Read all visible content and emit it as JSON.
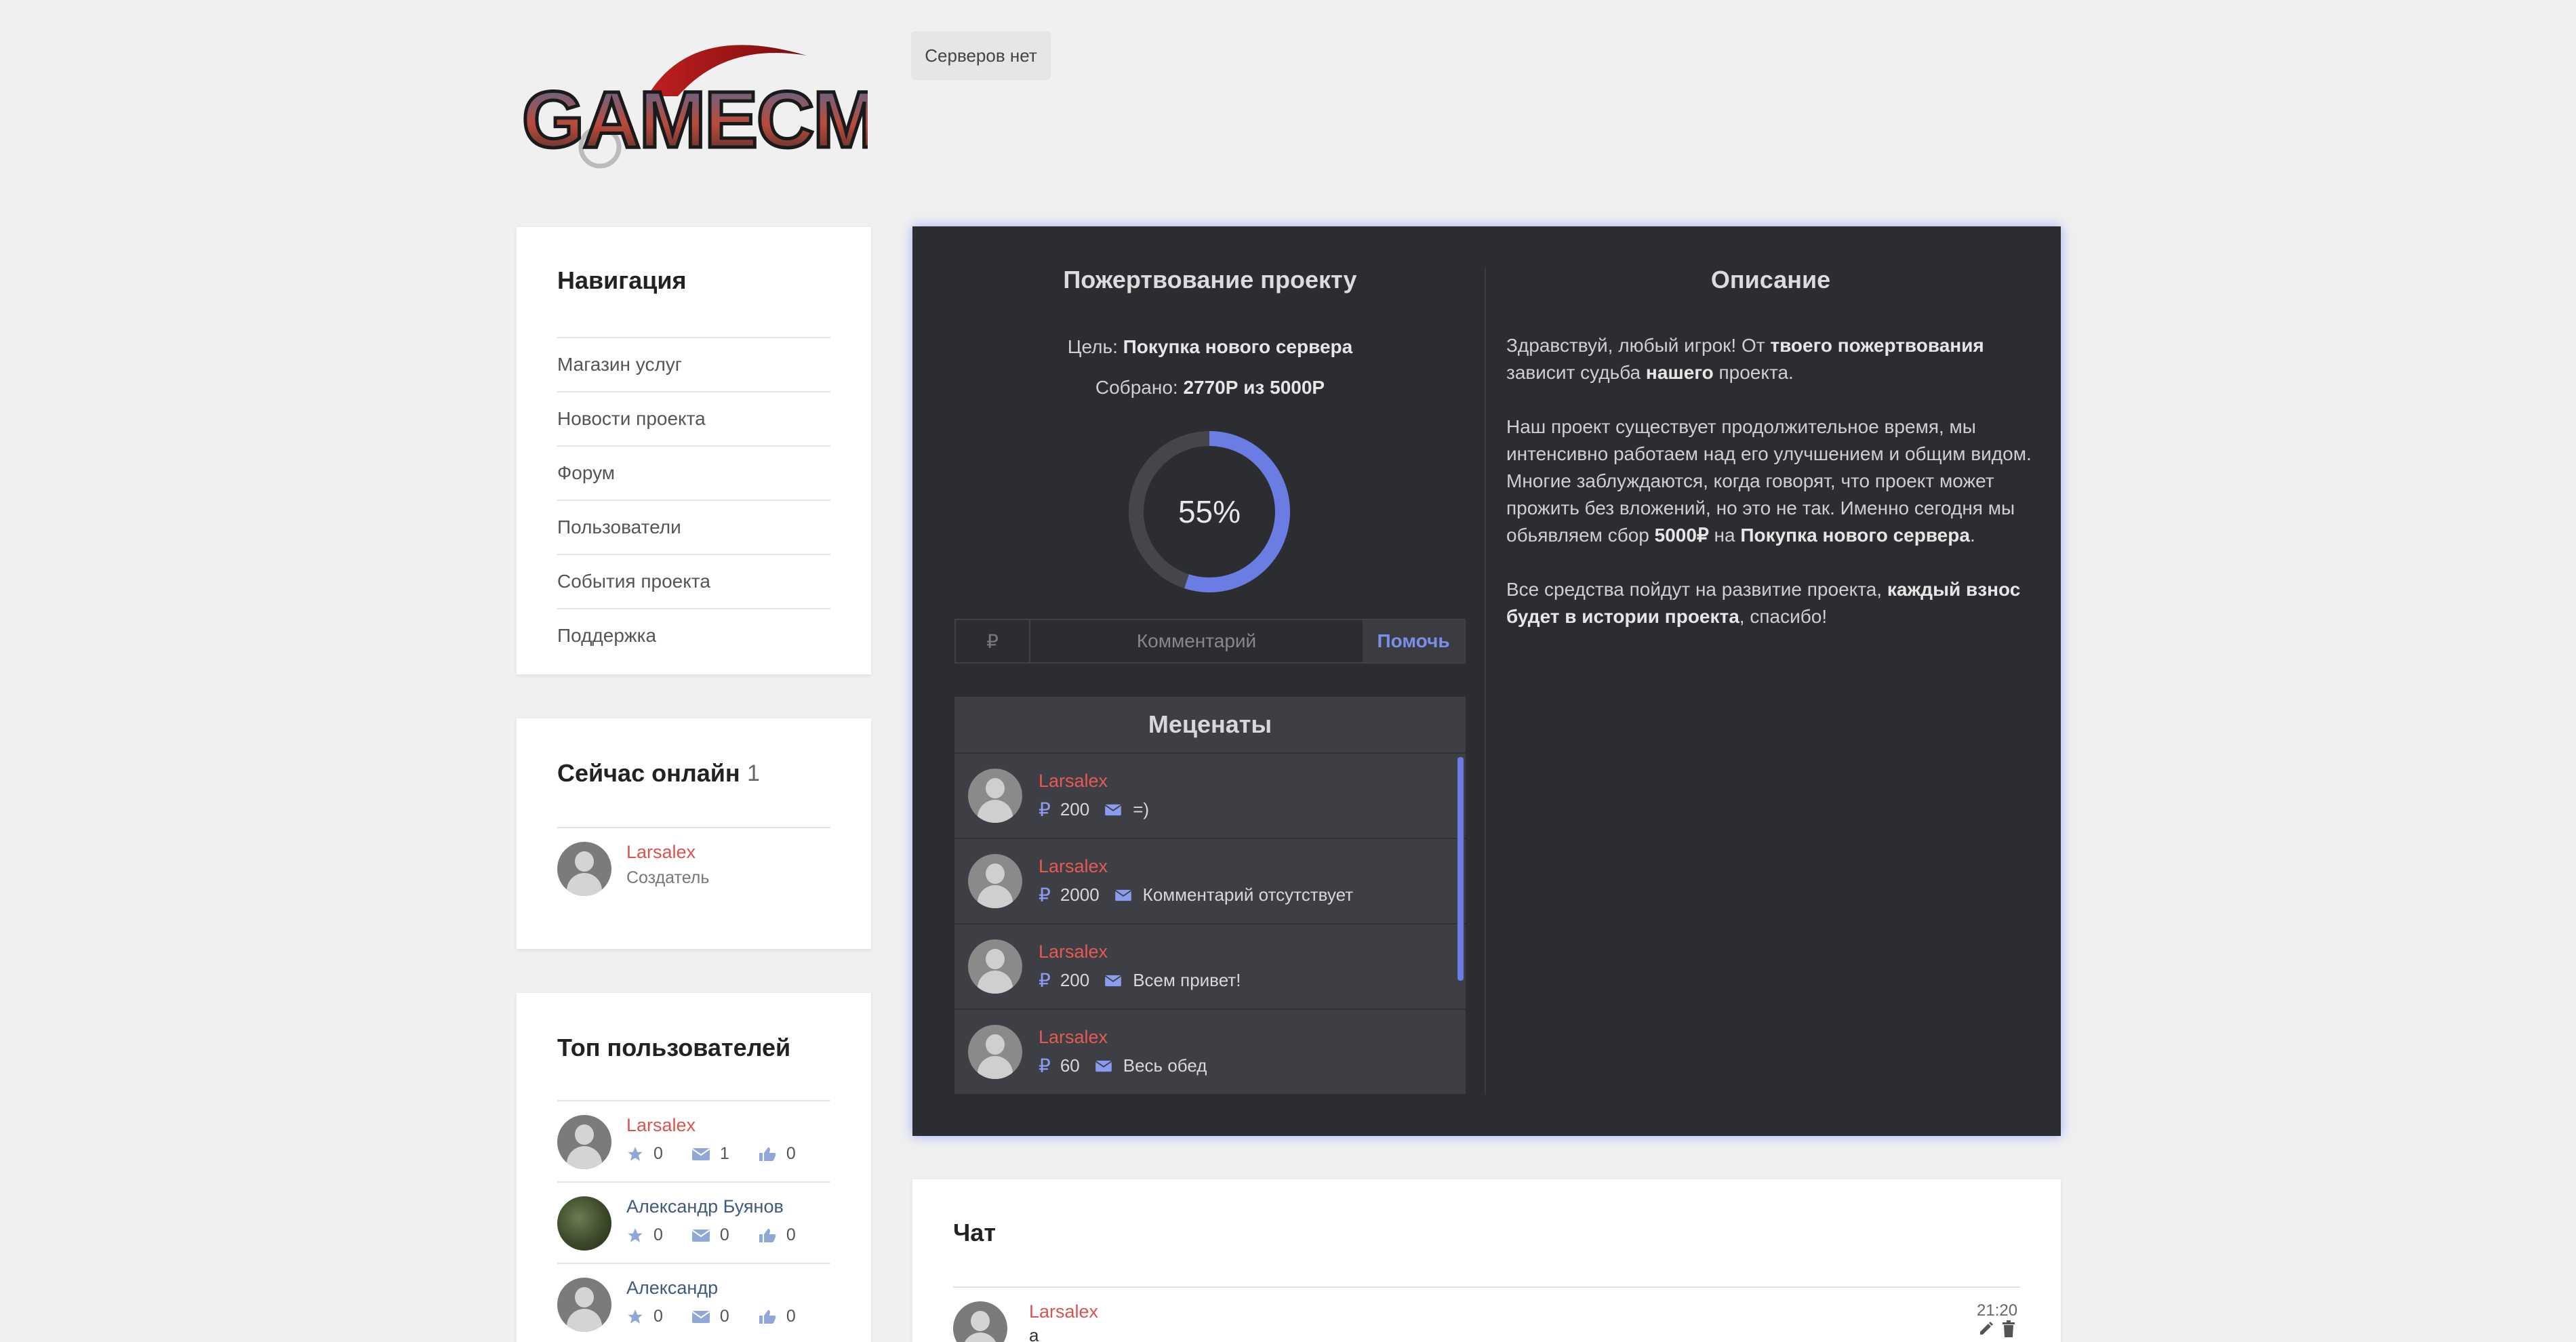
{
  "header": {
    "logo_text": "GAMECMS",
    "servers_label": "Серверов нет"
  },
  "nav": {
    "title": "Навигация",
    "items": [
      {
        "label": "Магазин услуг"
      },
      {
        "label": "Новости проекта"
      },
      {
        "label": "Форум"
      },
      {
        "label": "Пользователи"
      },
      {
        "label": "События проекта"
      },
      {
        "label": "Поддержка"
      }
    ]
  },
  "online": {
    "title": "Сейчас онлайн",
    "count": "1",
    "user": {
      "name": "Larsalex",
      "role": "Создатель"
    }
  },
  "top_users": {
    "title": "Топ пользователей",
    "users": [
      {
        "name": "Larsalex",
        "stars": "0",
        "messages": "1",
        "likes": "0"
      },
      {
        "name": "Александр Буянов",
        "stars": "0",
        "messages": "0",
        "likes": "0"
      },
      {
        "name": "Александр",
        "stars": "0",
        "messages": "0",
        "likes": "0"
      }
    ]
  },
  "donation": {
    "title": "Пожертвование проекту",
    "goal_label": "Цель:",
    "goal_value": "Покупка нового сервера",
    "collected_label": "Собрано:",
    "collected_value": "2770Р из 5000Р",
    "progress_percent": 55,
    "progress_text": "55%",
    "currency_symbol": "₽",
    "comment_placeholder": "Комментарий",
    "submit_label": "Помочь",
    "accent_color": "#6b7de3",
    "patrons_title": "Меценаты",
    "patrons": [
      {
        "name": "Larsalex",
        "amount": "200",
        "comment": "=)"
      },
      {
        "name": "Larsalex",
        "amount": "2000",
        "comment": "Комментарий отсутствует"
      },
      {
        "name": "Larsalex",
        "amount": "200",
        "comment": "Всем привет!"
      },
      {
        "name": "Larsalex",
        "amount": "60",
        "comment": "Весь обед"
      }
    ]
  },
  "description": {
    "title": "Описание",
    "p1_a": "Здравствуй, любый игрок! От ",
    "p1_b": "твоего пожертвования",
    "p1_c": " зависит судьба ",
    "p1_d": "нашего",
    "p1_e": " проекта.",
    "p2_a": "Наш проект существует продолжительное время, мы интенсивно работаем над его улучшением и общим видом. Многие заблуждаются, когда говорят, что проект может прожить без вложений, но это не так. Именно сегодня мы обьявляем сбор ",
    "p2_b": "5000₽",
    "p2_c": " на ",
    "p2_d": "Покупка нового сервера",
    "p2_e": ".",
    "p3_a": "Все средства пойдут на развитие проекта, ",
    "p3_b": "каждый взнос будет в истории проекта",
    "p3_c": ", спасибо!"
  },
  "chat": {
    "title": "Чат",
    "message": {
      "name": "Larsalex",
      "time": "21:20",
      "text": "a"
    }
  }
}
